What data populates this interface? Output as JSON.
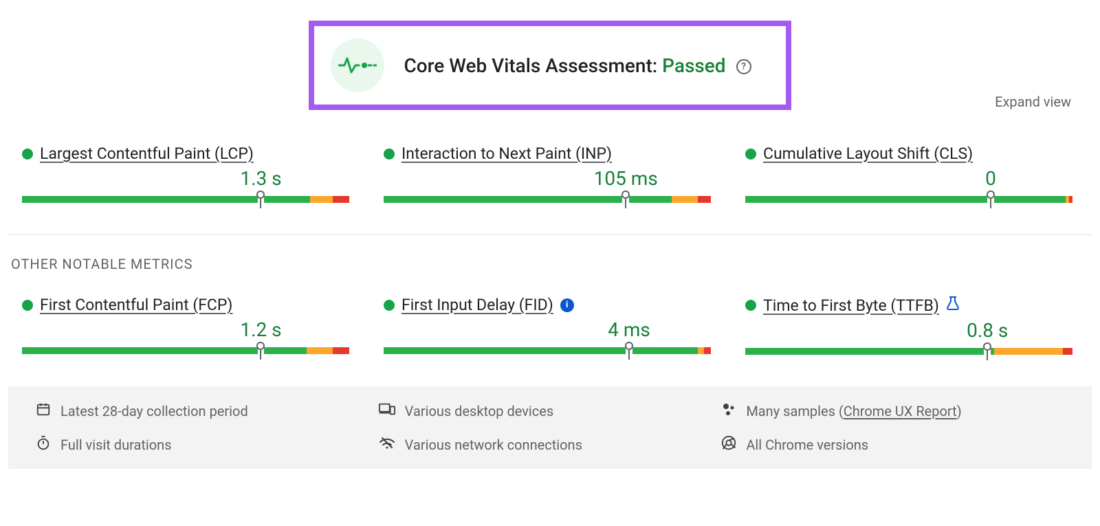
{
  "assessment": {
    "label": "Core Web Vitals Assessment:",
    "status": "Passed"
  },
  "expand_label": "Expand view",
  "core_metrics": [
    {
      "name": "Largest Contentful Paint (LCP)",
      "value": "1.3 s",
      "marker_pct": 73,
      "bar": {
        "green_main": 72,
        "gap": 2,
        "green_tail": 14,
        "orange": 7,
        "red": 5
      }
    },
    {
      "name": "Interaction to Next Paint (INP)",
      "value": "105 ms",
      "marker_pct": 74,
      "bar": {
        "green_main": 73,
        "gap": 2,
        "green_tail": 13,
        "orange": 8,
        "red": 4
      }
    },
    {
      "name": "Cumulative Layout Shift (CLS)",
      "value": "0",
      "marker_pct": 75,
      "bar": {
        "green_main": 74,
        "gap": 2,
        "green_tail": 22,
        "orange": 1,
        "red": 1
      }
    }
  ],
  "other_section_title": "OTHER NOTABLE METRICS",
  "other_metrics": [
    {
      "name": "First Contentful Paint (FCP)",
      "value": "1.2 s",
      "marker_pct": 73,
      "bar": {
        "green_main": 72,
        "gap": 2,
        "green_tail": 13,
        "orange": 8,
        "red": 5
      },
      "badge": null
    },
    {
      "name": "First Input Delay (FID)",
      "value": "4 ms",
      "marker_pct": 75,
      "bar": {
        "green_main": 74,
        "gap": 2,
        "green_tail": 20,
        "orange": 2,
        "red": 2
      },
      "badge": "info"
    },
    {
      "name": "Time to First Byte (TTFB)",
      "value": "0.8 s",
      "marker_pct": 74,
      "bar": {
        "green_main": 73,
        "gap": 2,
        "green_tail": 1,
        "orange": 21,
        "red": 3
      },
      "badge": "flask"
    }
  ],
  "footer": {
    "collection": "Latest 28-day collection period",
    "devices": "Various desktop devices",
    "samples_prefix": "Many samples (",
    "samples_link": "Chrome UX Report",
    "samples_suffix": ")",
    "durations": "Full visit durations",
    "network": "Various network connections",
    "chrome": "All Chrome versions"
  }
}
